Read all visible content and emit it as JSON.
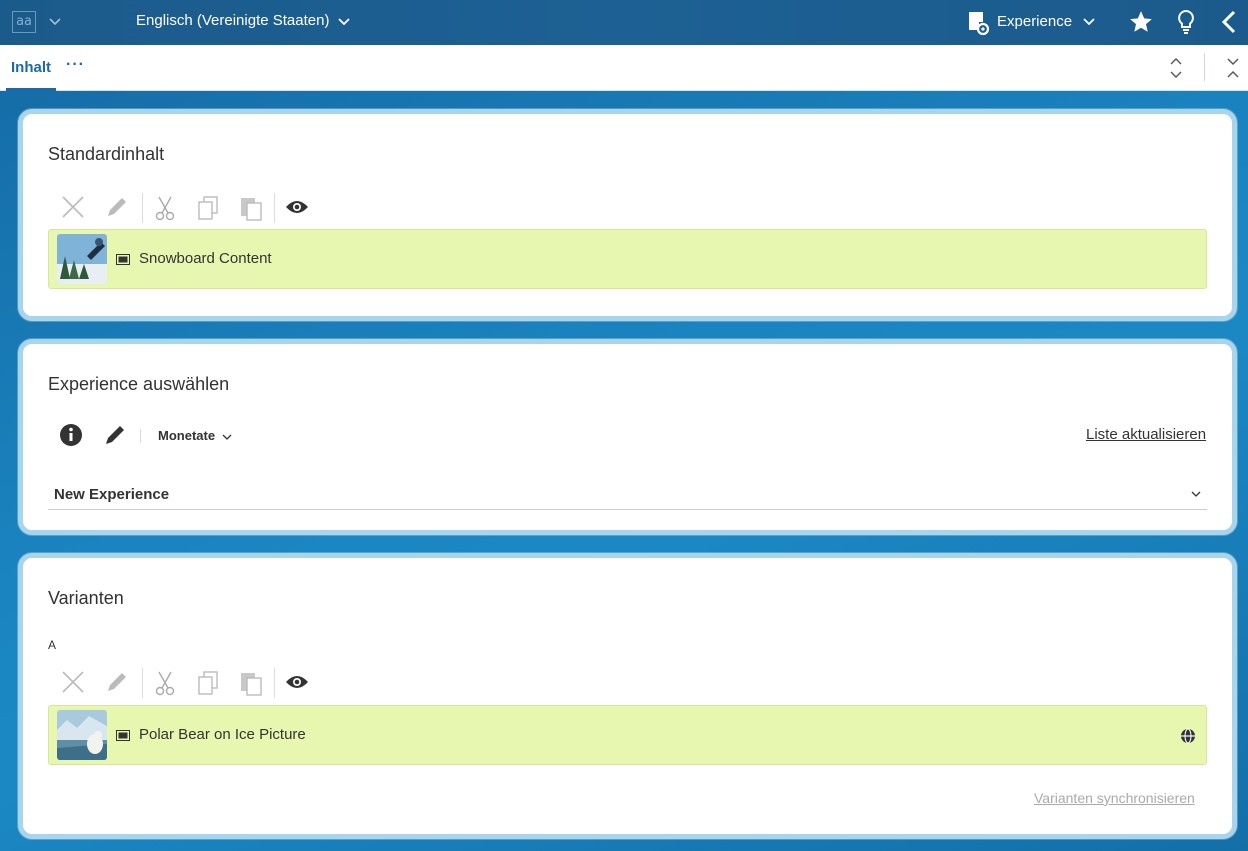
{
  "topbar": {
    "lang_icon": "aa",
    "locale_label": "Englisch (Vereinigte Staaten)",
    "experience_label": "Experience"
  },
  "tabs": {
    "inhalt": "Inhalt",
    "more": "···"
  },
  "standard": {
    "title": "Standardinhalt",
    "item_label": "Snowboard Content"
  },
  "experience": {
    "title": "Experience auswählen",
    "provider": "Monetate",
    "refresh_link": "Liste aktualisieren",
    "selected": "New Experience"
  },
  "variants": {
    "title": "Varianten",
    "variant_name": "A",
    "item_label": "Polar Bear on Ice Picture",
    "sync_link": "Varianten synchronisieren"
  },
  "colors": {
    "accent": "#1b6aa5",
    "item_background": "#e8f7b0",
    "panel_border": "#a8d4ec"
  },
  "icons": [
    "lang-icon",
    "chevron-down-icon",
    "document-settings-icon",
    "star-icon",
    "lightbulb-icon",
    "back-icon",
    "collapse-icon",
    "expand-icon",
    "close-icon",
    "pencil-icon",
    "scissors-icon",
    "copy-icon",
    "paste-icon",
    "eye-icon",
    "info-icon",
    "picture-icon",
    "globe-icon"
  ]
}
